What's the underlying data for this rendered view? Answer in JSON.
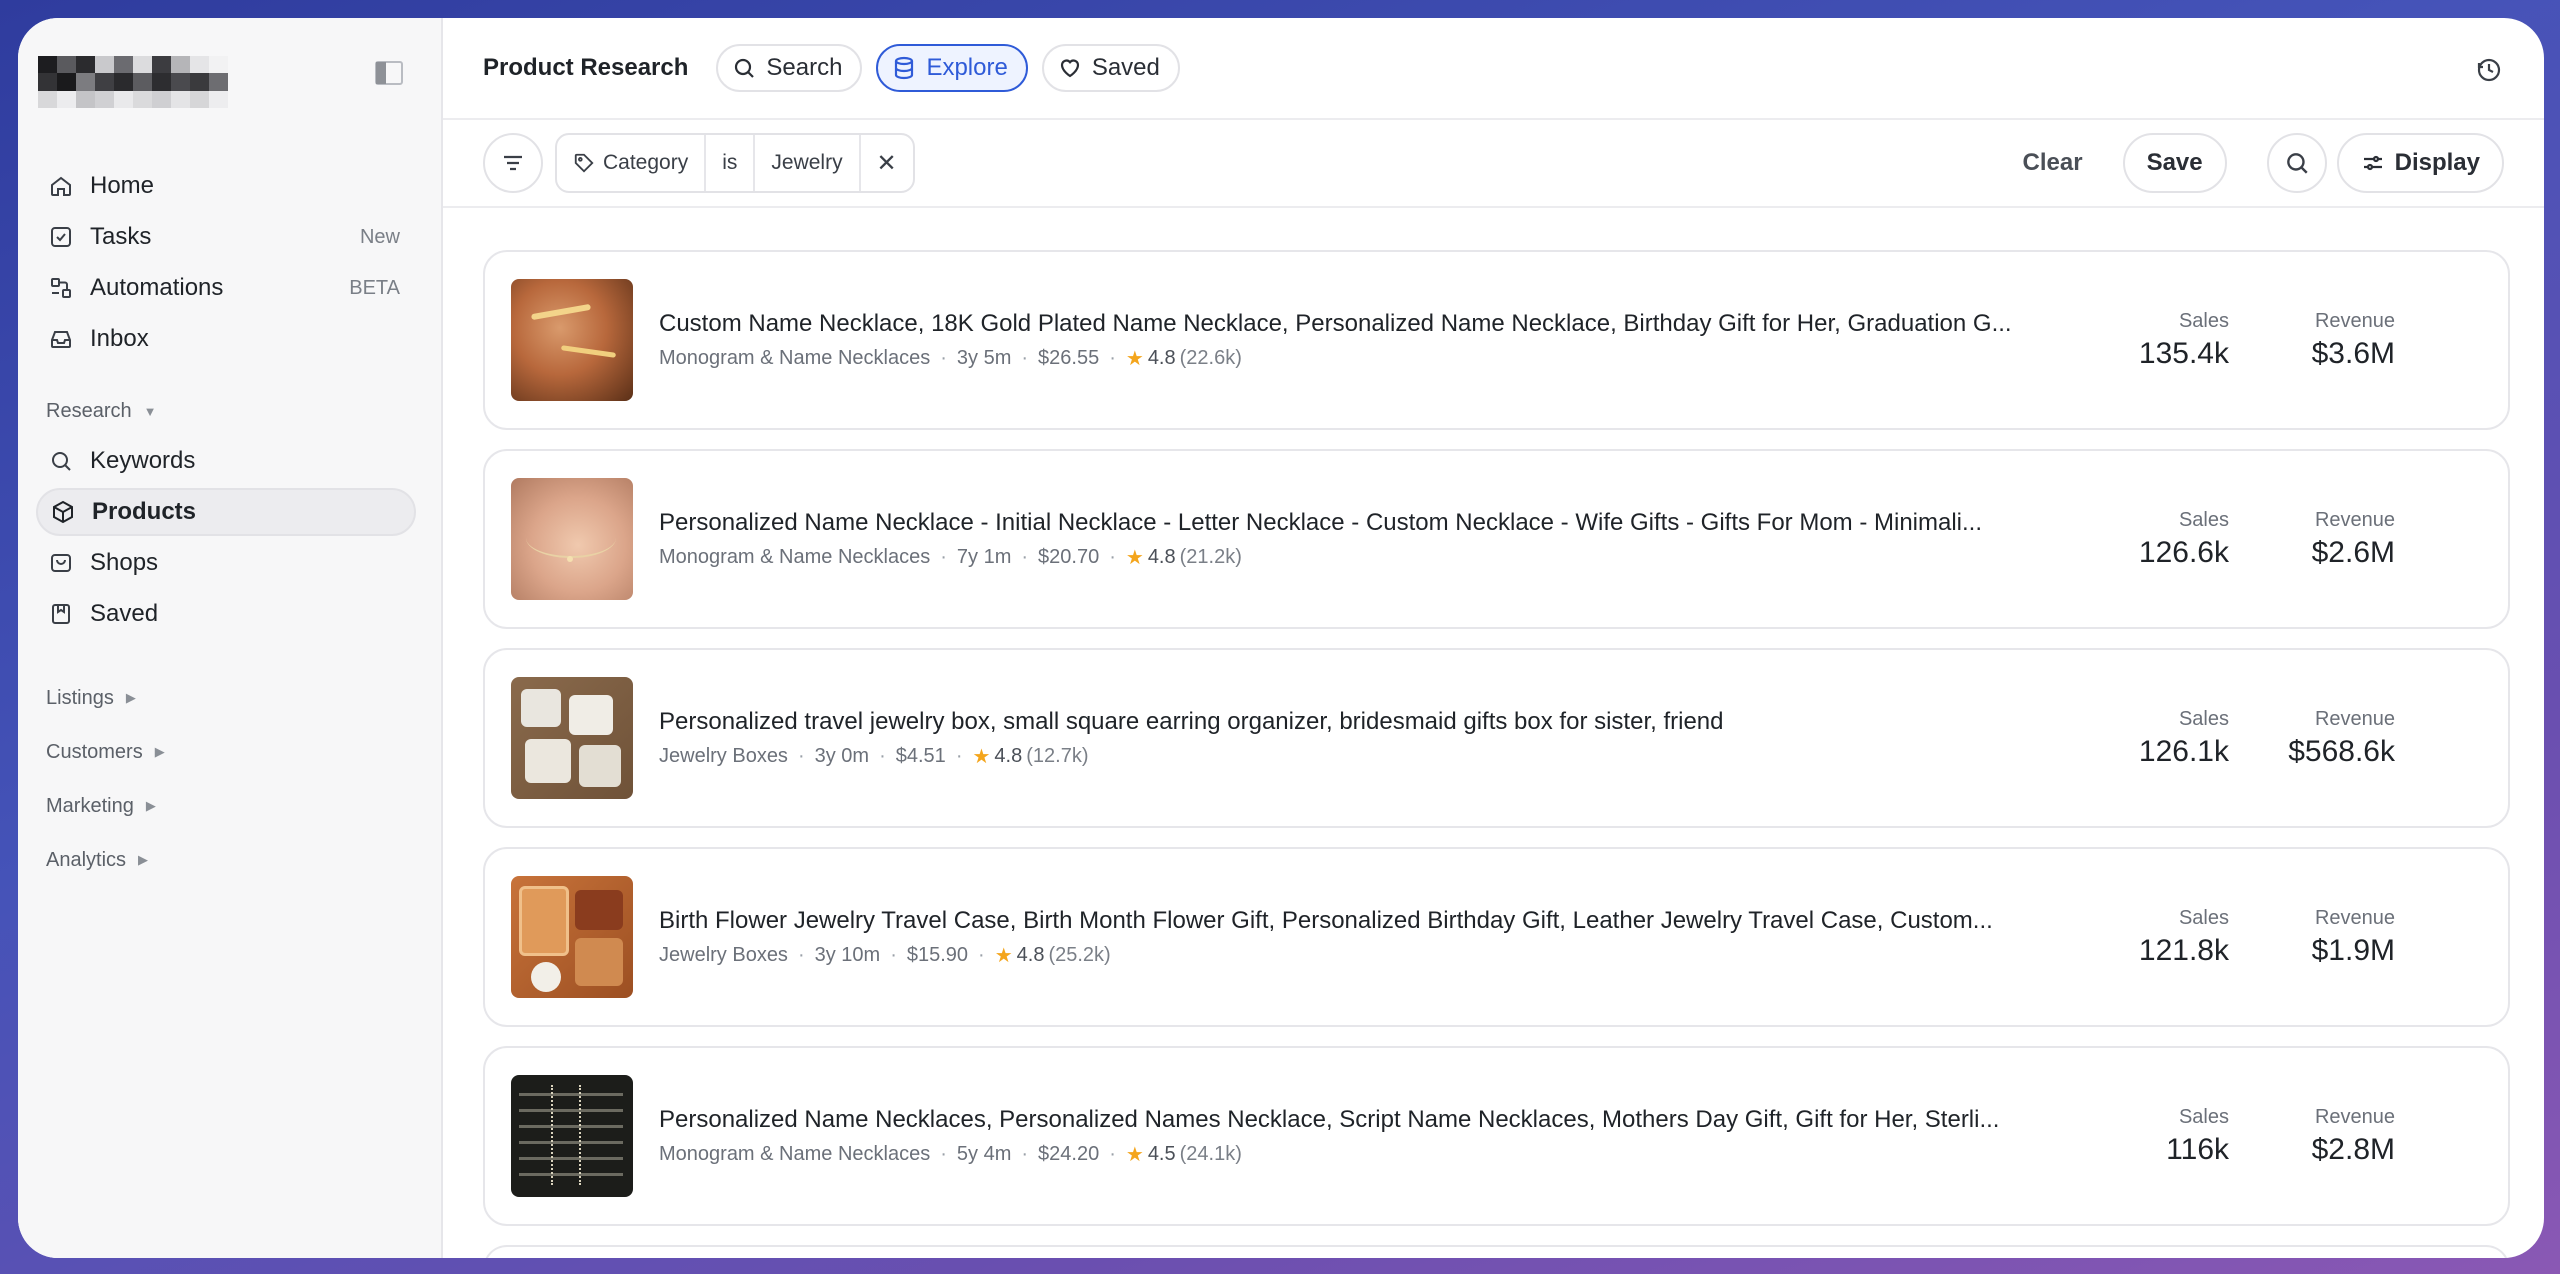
{
  "sidebar": {
    "nav": [
      {
        "label": "Home",
        "badge": "",
        "icon": "home-icon"
      },
      {
        "label": "Tasks",
        "badge": "New",
        "icon": "checkbox-icon"
      },
      {
        "label": "Automations",
        "badge": "BETA",
        "icon": "automation-icon"
      },
      {
        "label": "Inbox",
        "badge": "",
        "icon": "inbox-icon"
      }
    ],
    "research_heading": "Research",
    "research": [
      {
        "label": "Keywords",
        "icon": "search-icon"
      },
      {
        "label": "Products",
        "icon": "box-icon",
        "active": true
      },
      {
        "label": "Shops",
        "icon": "shop-icon"
      },
      {
        "label": "Saved",
        "icon": "bookmark-icon"
      }
    ],
    "sections": [
      "Listings",
      "Customers",
      "Marketing",
      "Analytics"
    ]
  },
  "topbar": {
    "title": "Product Research",
    "tabs": [
      {
        "label": "Search",
        "icon": "search-icon"
      },
      {
        "label": "Explore",
        "icon": "database-icon",
        "active": true
      },
      {
        "label": "Saved",
        "icon": "heart-icon"
      }
    ]
  },
  "filter": {
    "field": "Category",
    "operator": "is",
    "value": "Jewelry",
    "clear_label": "Clear",
    "save_label": "Save",
    "display_label": "Display"
  },
  "stat_labels": {
    "sales": "Sales",
    "revenue": "Revenue"
  },
  "products": [
    {
      "title": "Custom Name Necklace, 18K Gold Plated Name Necklace, Personalized Name Necklace, Birthday Gift for Her, Graduation G...",
      "category": "Monogram & Name Necklaces",
      "age": "3y 5m",
      "price": "$26.55",
      "rating": "4.8",
      "reviews": "(22.6k)",
      "sales": "135.4k",
      "revenue": "$3.6M"
    },
    {
      "title": "Personalized Name Necklace - Initial Necklace - Letter Necklace - Custom Necklace - Wife Gifts - Gifts For Mom - Minimali...",
      "category": "Monogram & Name Necklaces",
      "age": "7y 1m",
      "price": "$20.70",
      "rating": "4.8",
      "reviews": "(21.2k)",
      "sales": "126.6k",
      "revenue": "$2.6M"
    },
    {
      "title": "Personalized travel jewelry box, small square earring organizer, bridesmaid gifts box for sister, friend",
      "category": "Jewelry Boxes",
      "age": "3y 0m",
      "price": "$4.51",
      "rating": "4.8",
      "reviews": "(12.7k)",
      "sales": "126.1k",
      "revenue": "$568.6k"
    },
    {
      "title": "Birth Flower Jewelry Travel Case, Birth Month Flower Gift, Personalized Birthday Gift, Leather Jewelry Travel Case, Custom...",
      "category": "Jewelry Boxes",
      "age": "3y 10m",
      "price": "$15.90",
      "rating": "4.8",
      "reviews": "(25.2k)",
      "sales": "121.8k",
      "revenue": "$1.9M"
    },
    {
      "title": "Personalized Name Necklaces, Personalized Names Necklace, Script Name Necklaces, Mothers Day Gift, Gift for Her, Sterli...",
      "category": "Monogram & Name Necklaces",
      "age": "5y 4m",
      "price": "$24.20",
      "rating": "4.5",
      "reviews": "(24.1k)",
      "sales": "116k",
      "revenue": "$2.8M"
    }
  ],
  "colors": {
    "accent": "#2f5bd8",
    "star": "#f4a51c"
  }
}
